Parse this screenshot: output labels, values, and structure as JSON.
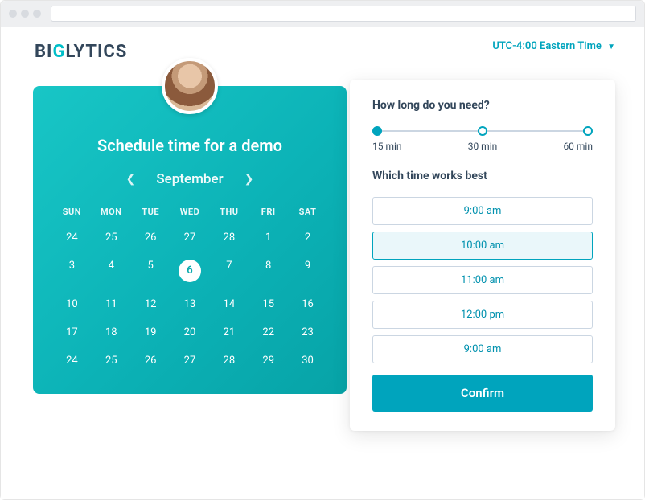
{
  "timezone": "UTC-4:00 Eastern Time",
  "brand": {
    "pre": "BI",
    "accent": "G",
    "post": "LYTICS"
  },
  "calendar": {
    "title": "Schedule time for a demo",
    "month": "September",
    "dow": [
      "SUN",
      "MON",
      "TUE",
      "WED",
      "THU",
      "FRI",
      "SAT"
    ],
    "selected": 6,
    "weeks": [
      [
        24,
        25,
        26,
        27,
        28,
        1,
        2
      ],
      [
        3,
        4,
        5,
        6,
        7,
        8,
        9
      ],
      [
        10,
        11,
        12,
        13,
        14,
        15,
        16
      ],
      [
        17,
        18,
        19,
        20,
        21,
        22,
        23
      ],
      [
        24,
        25,
        26,
        27,
        28,
        29,
        30
      ]
    ]
  },
  "duration": {
    "heading": "How long do you need?",
    "options": [
      "15 min",
      "30 min",
      "60 min"
    ],
    "active_index": 0
  },
  "times": {
    "heading": "Which time works best",
    "slots": [
      "9:00 am",
      "10:00 am",
      "11:00 am",
      "12:00 pm",
      "9:00 am"
    ],
    "selected_index": 1
  },
  "confirm_label": "Confirm"
}
